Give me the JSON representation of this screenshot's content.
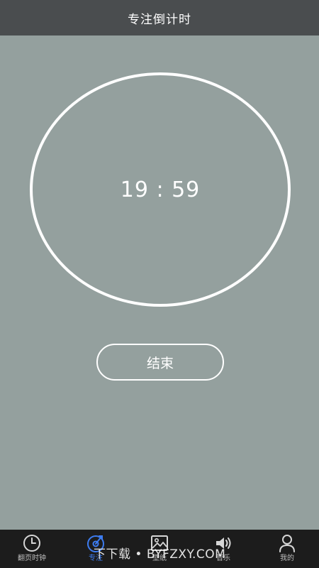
{
  "header": {
    "title": "专注倒计时"
  },
  "timer": {
    "display": "19 : 59"
  },
  "actions": {
    "end_label": "结束"
  },
  "tabbar": {
    "tabs": [
      {
        "label": "翻页时钟",
        "icon": "clock-icon",
        "active": false
      },
      {
        "label": "专注",
        "icon": "focus-icon",
        "active": true
      },
      {
        "label": "壁纸",
        "icon": "wallpaper-icon",
        "active": false
      },
      {
        "label": "音乐",
        "icon": "speaker-icon",
        "active": false
      },
      {
        "label": "我的",
        "icon": "user-icon",
        "active": false
      }
    ]
  },
  "watermark": {
    "text": "下下载 • BYFZXY.COM"
  },
  "colors": {
    "background": "#94a09e",
    "header": "#4a4d4f",
    "tabbar": "#1c1c1c",
    "accent": "#3d7cf0",
    "foreground": "#ffffff"
  }
}
